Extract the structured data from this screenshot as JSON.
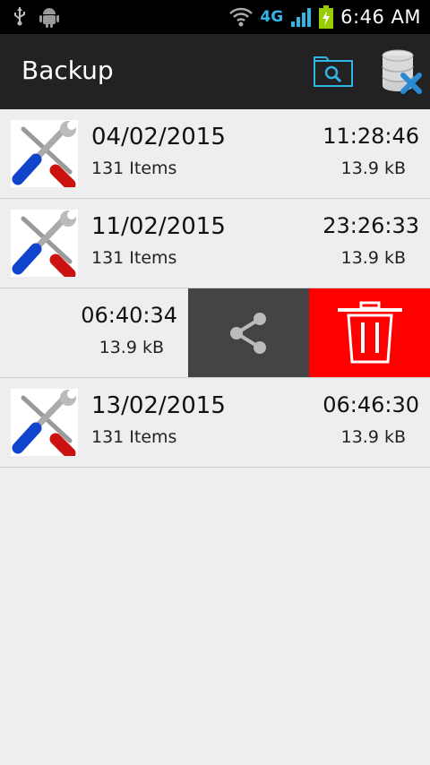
{
  "status_bar": {
    "network": "4G",
    "time": "6:46 AM"
  },
  "action_bar": {
    "title": "Backup",
    "icons": [
      "folder-search-icon",
      "database-delete-icon"
    ]
  },
  "backups": [
    {
      "date": "04/02/2015",
      "items": "131 Items",
      "time": "11:28:46",
      "size": "13.9 kB"
    },
    {
      "date": "11/02/2015",
      "items": "131 Items",
      "time": "23:26:33",
      "size": "13.9 kB"
    },
    {
      "date": "",
      "items": "",
      "time": "06:40:34",
      "size": "13.9 kB"
    },
    {
      "date": "13/02/2015",
      "items": "131 Items",
      "time": "06:46:30",
      "size": "13.9 kB"
    }
  ],
  "swipe_actions": {
    "share_icon": "share-icon",
    "delete_icon": "trash-icon"
  },
  "colors": {
    "action_bar": "#222222",
    "accent": "#33b5e5",
    "delete": "#ff0000",
    "share": "#444444"
  }
}
